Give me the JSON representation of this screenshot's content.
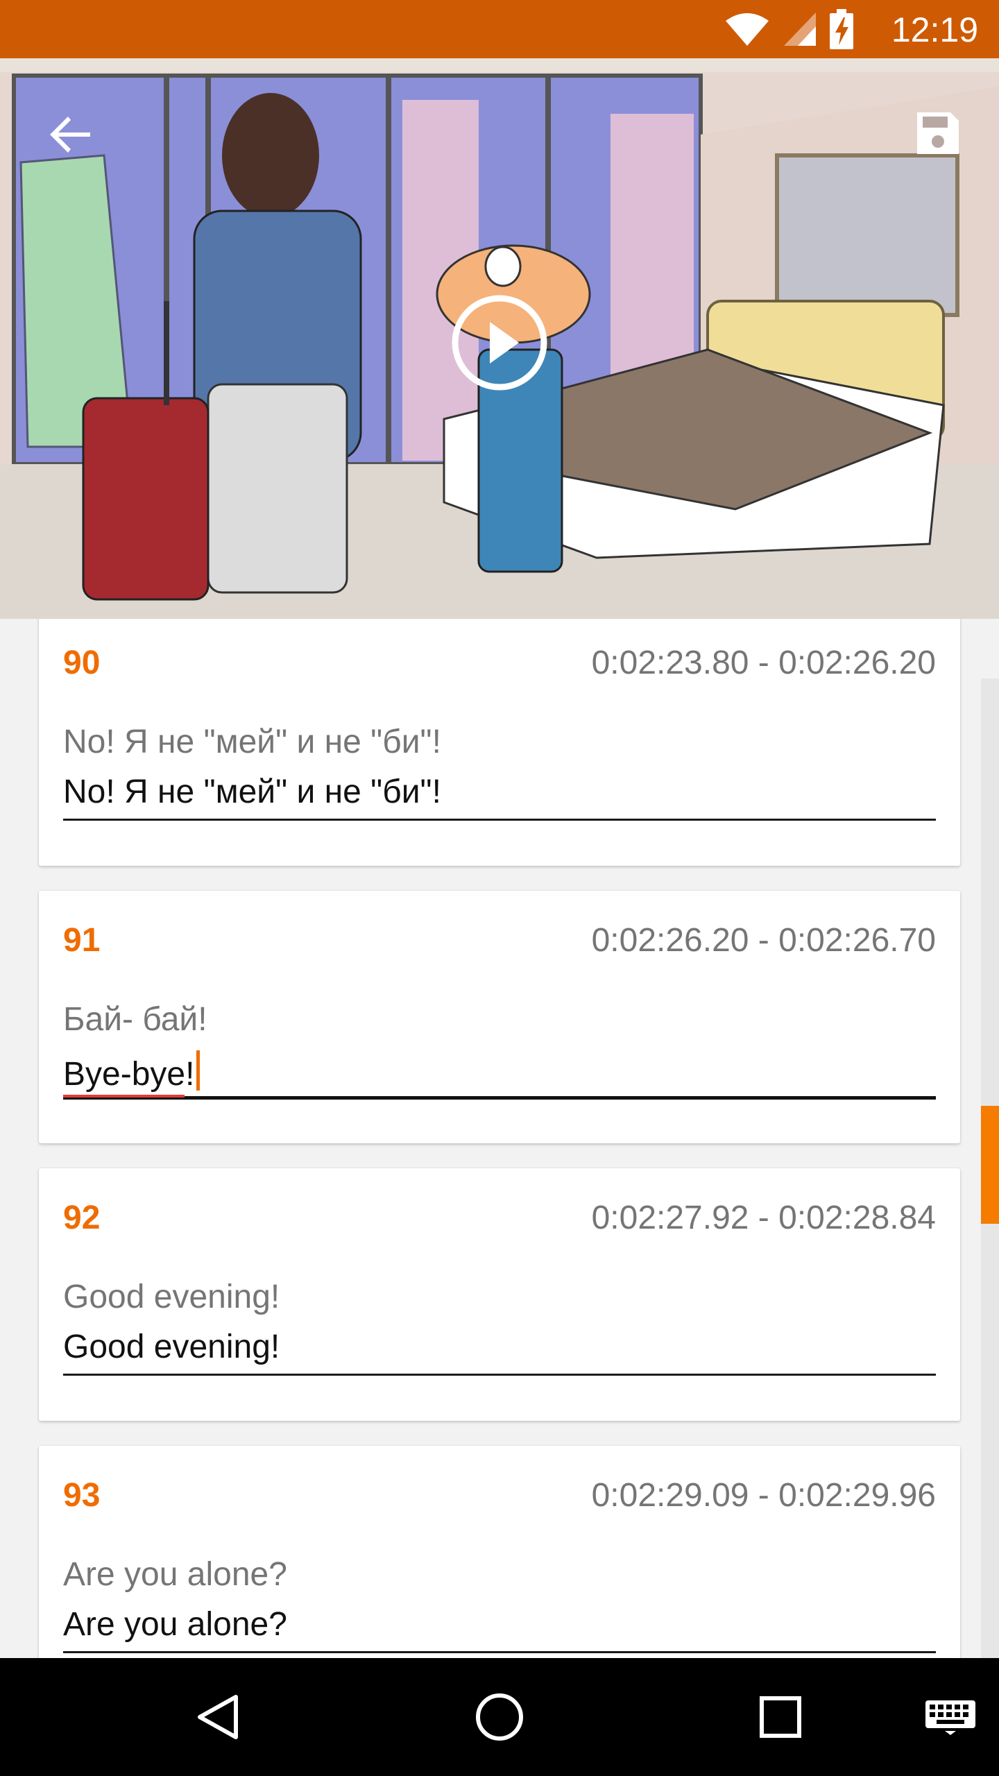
{
  "status_bar": {
    "time": "12:19",
    "icons": [
      "wifi-icon",
      "signal-icon",
      "battery-charging-icon"
    ],
    "color": "#cf5a04"
  },
  "video": {
    "icons": [
      "back-arrow-icon",
      "save-icon",
      "play-icon"
    ]
  },
  "subtitles": [
    {
      "index": "90",
      "time_range": "0:02:23.80 - 0:02:26.20",
      "original": "No! Я не \"мей\" и не \"би\"!",
      "edited": "No! Я не \"мей\" и не \"би\"!"
    },
    {
      "index": "91",
      "time_range": "0:02:26.20 - 0:02:26.70",
      "original": "Бай- бай!",
      "edited": "Bye-bye!"
    },
    {
      "index": "92",
      "time_range": "0:02:27.92 - 0:02:28.84",
      "original": "Good evening!",
      "edited": "Good evening!"
    },
    {
      "index": "93",
      "time_range": "0:02:29.09 - 0:02:29.96",
      "original": "Are you alone?",
      "edited": "Are you alone?"
    }
  ],
  "colors": {
    "accent": "#ef6c00",
    "secondary_text": "#757575",
    "spellcheck": "#e53935"
  },
  "nav_bar": {
    "icons": [
      "back-triangle-icon",
      "home-circle-icon",
      "recents-square-icon",
      "keyboard-icon"
    ]
  }
}
